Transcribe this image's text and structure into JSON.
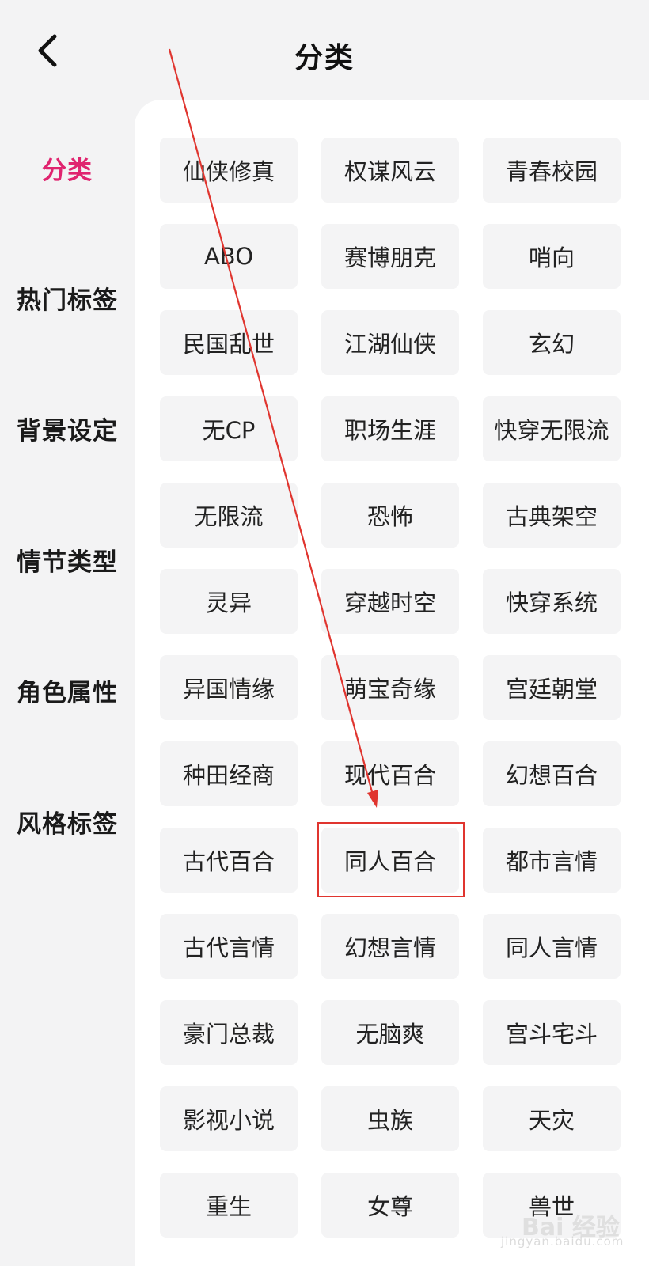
{
  "header": {
    "title": "分类",
    "back_icon": "chevron-left-icon"
  },
  "sidebar": {
    "items": [
      {
        "label": "分类",
        "active": true
      },
      {
        "label": "热门标签",
        "active": false
      },
      {
        "label": "背景设定",
        "active": false
      },
      {
        "label": "情节类型",
        "active": false
      },
      {
        "label": "角色属性",
        "active": false
      },
      {
        "label": "风格标签",
        "active": false
      }
    ],
    "active_color": "#e0246f"
  },
  "tags": [
    "仙侠修真",
    "权谋风云",
    "青春校园",
    "ABO",
    "赛博朋克",
    "哨向",
    "民国乱世",
    "江湖仙侠",
    "玄幻",
    "无CP",
    "职场生涯",
    "快穿无限流",
    "无限流",
    "恐怖",
    "古典架空",
    "灵异",
    "穿越时空",
    "快穿系统",
    "异国情缘",
    "萌宝奇缘",
    "宫廷朝堂",
    "种田经商",
    "现代百合",
    "幻想百合",
    "古代百合",
    "同人百合",
    "都市言情",
    "古代言情",
    "幻想言情",
    "同人言情",
    "豪门总裁",
    "无脑爽",
    "宫斗宅斗",
    "影视小说",
    "虫族",
    "天灾",
    "重生",
    "女尊",
    "兽世"
  ],
  "annotation": {
    "highlighted_tag": "同人百合",
    "color": "#e0352f"
  },
  "watermark": {
    "text": "Bai 经验",
    "url": "jingyan.baidu.com"
  }
}
